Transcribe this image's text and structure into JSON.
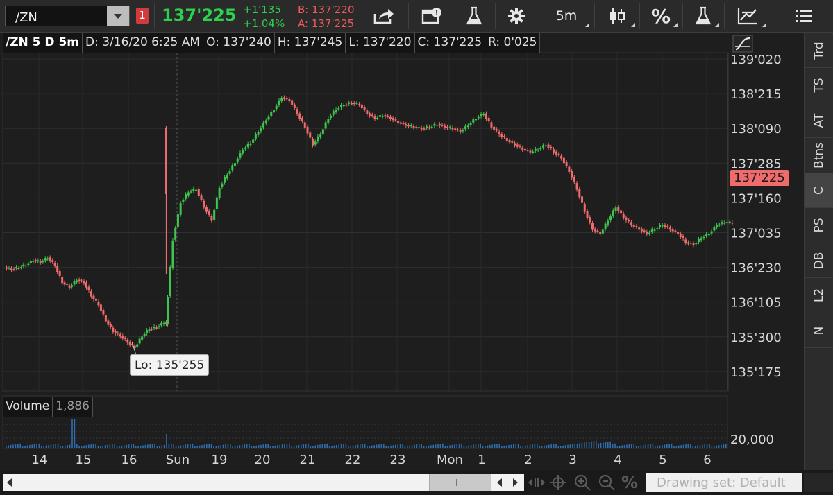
{
  "toolbar": {
    "symbol": "/ZN",
    "link_badge": "1",
    "last_price": "137'225",
    "net_change": "+1'135",
    "pct_change": "+1.04%",
    "bid": "B: 137'220",
    "ask": "A: 137'225",
    "timeframe": "5m",
    "percent_label": "%",
    "colors": {
      "up": "#2ed14e",
      "down": "#f05a5a",
      "badge": "#d23b3b"
    }
  },
  "info_bar": {
    "title": "/ZN 5 D 5m",
    "date": "D: 3/16/20 6:25 AM",
    "open": "O: 137'240",
    "high": "H: 137'245",
    "low": "L: 137'220",
    "close": "C: 137'225",
    "range": "R: 0'025"
  },
  "price_axis": {
    "ticks": [
      "139'020",
      "138'215",
      "138'090",
      "137'285",
      "137'160",
      "137'035",
      "136'230",
      "136'105",
      "135'300",
      "135'175"
    ],
    "current_price_tag": "137'225"
  },
  "annotations": {
    "low_label": "Lo: 135'255"
  },
  "volume_panel": {
    "label": "Volume",
    "value": "1,886",
    "tick": "20,000"
  },
  "x_axis": {
    "labels": [
      "14",
      "15",
      "16",
      "Sun",
      "19",
      "20",
      "21",
      "22",
      "23",
      "Mon",
      "1",
      "2",
      "3",
      "4",
      "5",
      "6"
    ]
  },
  "side_tabs": [
    "Trd",
    "TS",
    "AT",
    "Btns",
    "C",
    "PS",
    "DB",
    "L2",
    "N"
  ],
  "side_tab_active": "C",
  "bottom_bar": {
    "drawing_set": "Drawing set: Default",
    "percent_label": "%"
  },
  "chart_data": {
    "type": "candlestick",
    "title": "",
    "ylabel": "",
    "ylim_32nds": [
      135.5,
      139.15
    ],
    "current": "137'225",
    "low": "135'255",
    "up_color": "#3ec54f",
    "down_color": "#f06b6b",
    "close_path": [
      136.7,
      136.72,
      136.75,
      136.8,
      136.78,
      136.83,
      136.74,
      136.55,
      136.5,
      136.58,
      136.55,
      136.4,
      136.3,
      136.12,
      136.0,
      135.95,
      135.88,
      135.82,
      135.95,
      136.03,
      136.05,
      136.1,
      136.08,
      137.03,
      137.45,
      137.57,
      137.6,
      137.4,
      137.25,
      137.62,
      137.77,
      137.9,
      138.05,
      138.12,
      138.25,
      138.38,
      138.5,
      138.63,
      138.6,
      138.45,
      138.3,
      138.1,
      138.22,
      138.4,
      138.5,
      138.55,
      138.57,
      138.55,
      138.45,
      138.4,
      138.43,
      138.4,
      138.35,
      138.32,
      138.3,
      138.28,
      138.3,
      138.33,
      138.3,
      138.28,
      138.25,
      138.32,
      138.4,
      138.45,
      138.3,
      138.22,
      138.15,
      138.1,
      138.05,
      138.02,
      138.05,
      138.1,
      138.02,
      137.95,
      137.8,
      137.6,
      137.35,
      137.15,
      137.1,
      137.25,
      137.4,
      137.28,
      137.2,
      137.15,
      137.1,
      137.15,
      137.2,
      137.15,
      137.1,
      137.0,
      136.98,
      137.05,
      137.1,
      137.2,
      137.23,
      137.22
    ]
  }
}
